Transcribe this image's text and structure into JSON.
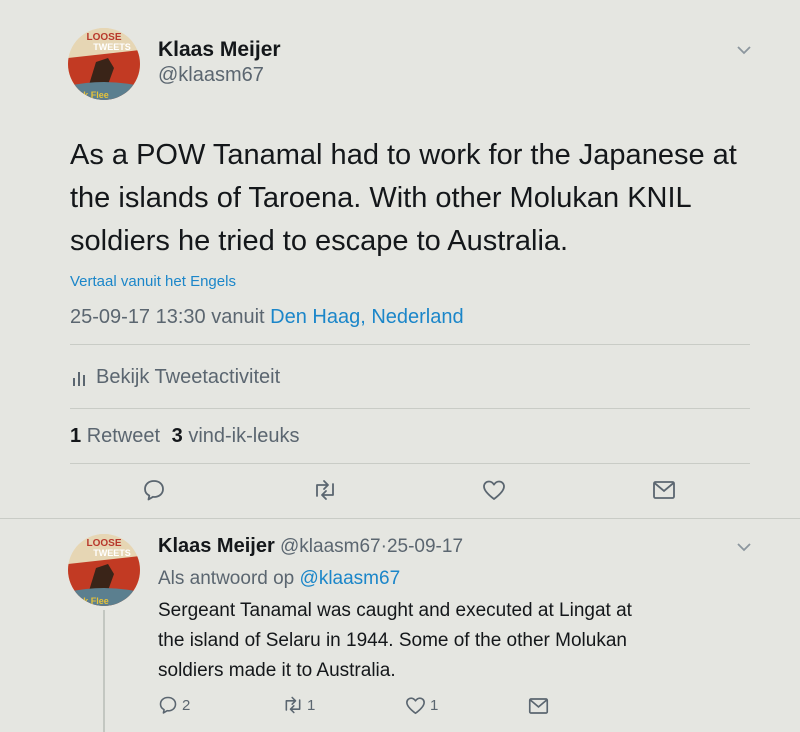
{
  "main_tweet": {
    "avatar_text_top": "LOOSE",
    "avatar_text_mid": "TWEETS",
    "avatar_text_bottom": "k Flee",
    "author_name": "Klaas Meijer",
    "author_handle": "@klaasm67",
    "text": "As a POW Tanamal had to work for the Japanese at the islands of Taroena. With other Molukan KNIL soldiers he tried to escape to Australia.",
    "translate_label": "Vertaal vanuit het Engels",
    "timestamp": "25-09-17 13:30 vanuit",
    "location": "Den Haag, Nederland",
    "activity_label": "Bekijk Tweetactiviteit",
    "retweet_count": "1",
    "retweet_label": "Retweet",
    "like_count": "3",
    "like_label": "vind-ik-leuks"
  },
  "reply_tweet": {
    "author_name": "Klaas Meijer",
    "author_handle": "@klaasm67",
    "separator": "·",
    "date": "25-09-17",
    "reply_prefix": "Als antwoord op",
    "reply_handle": "@klaasm67",
    "text_line1": "Sergeant Tanamal was caught and executed at Lingat at",
    "text_line2": "the island of Selaru in 1944. Some of the other Molukan",
    "text_line3": "soldiers made it to Australia.",
    "reply_count": "2",
    "retweet_count": "1",
    "like_count": "1"
  },
  "colors": {
    "background": "#e5e6e1",
    "link": "#1b86c9",
    "secondary_text": "#5b6670",
    "icon": "#5b6670"
  },
  "icons": [
    "chevron-down-icon",
    "bar-chart-icon",
    "reply-icon",
    "retweet-icon",
    "heart-icon",
    "message-icon"
  ]
}
